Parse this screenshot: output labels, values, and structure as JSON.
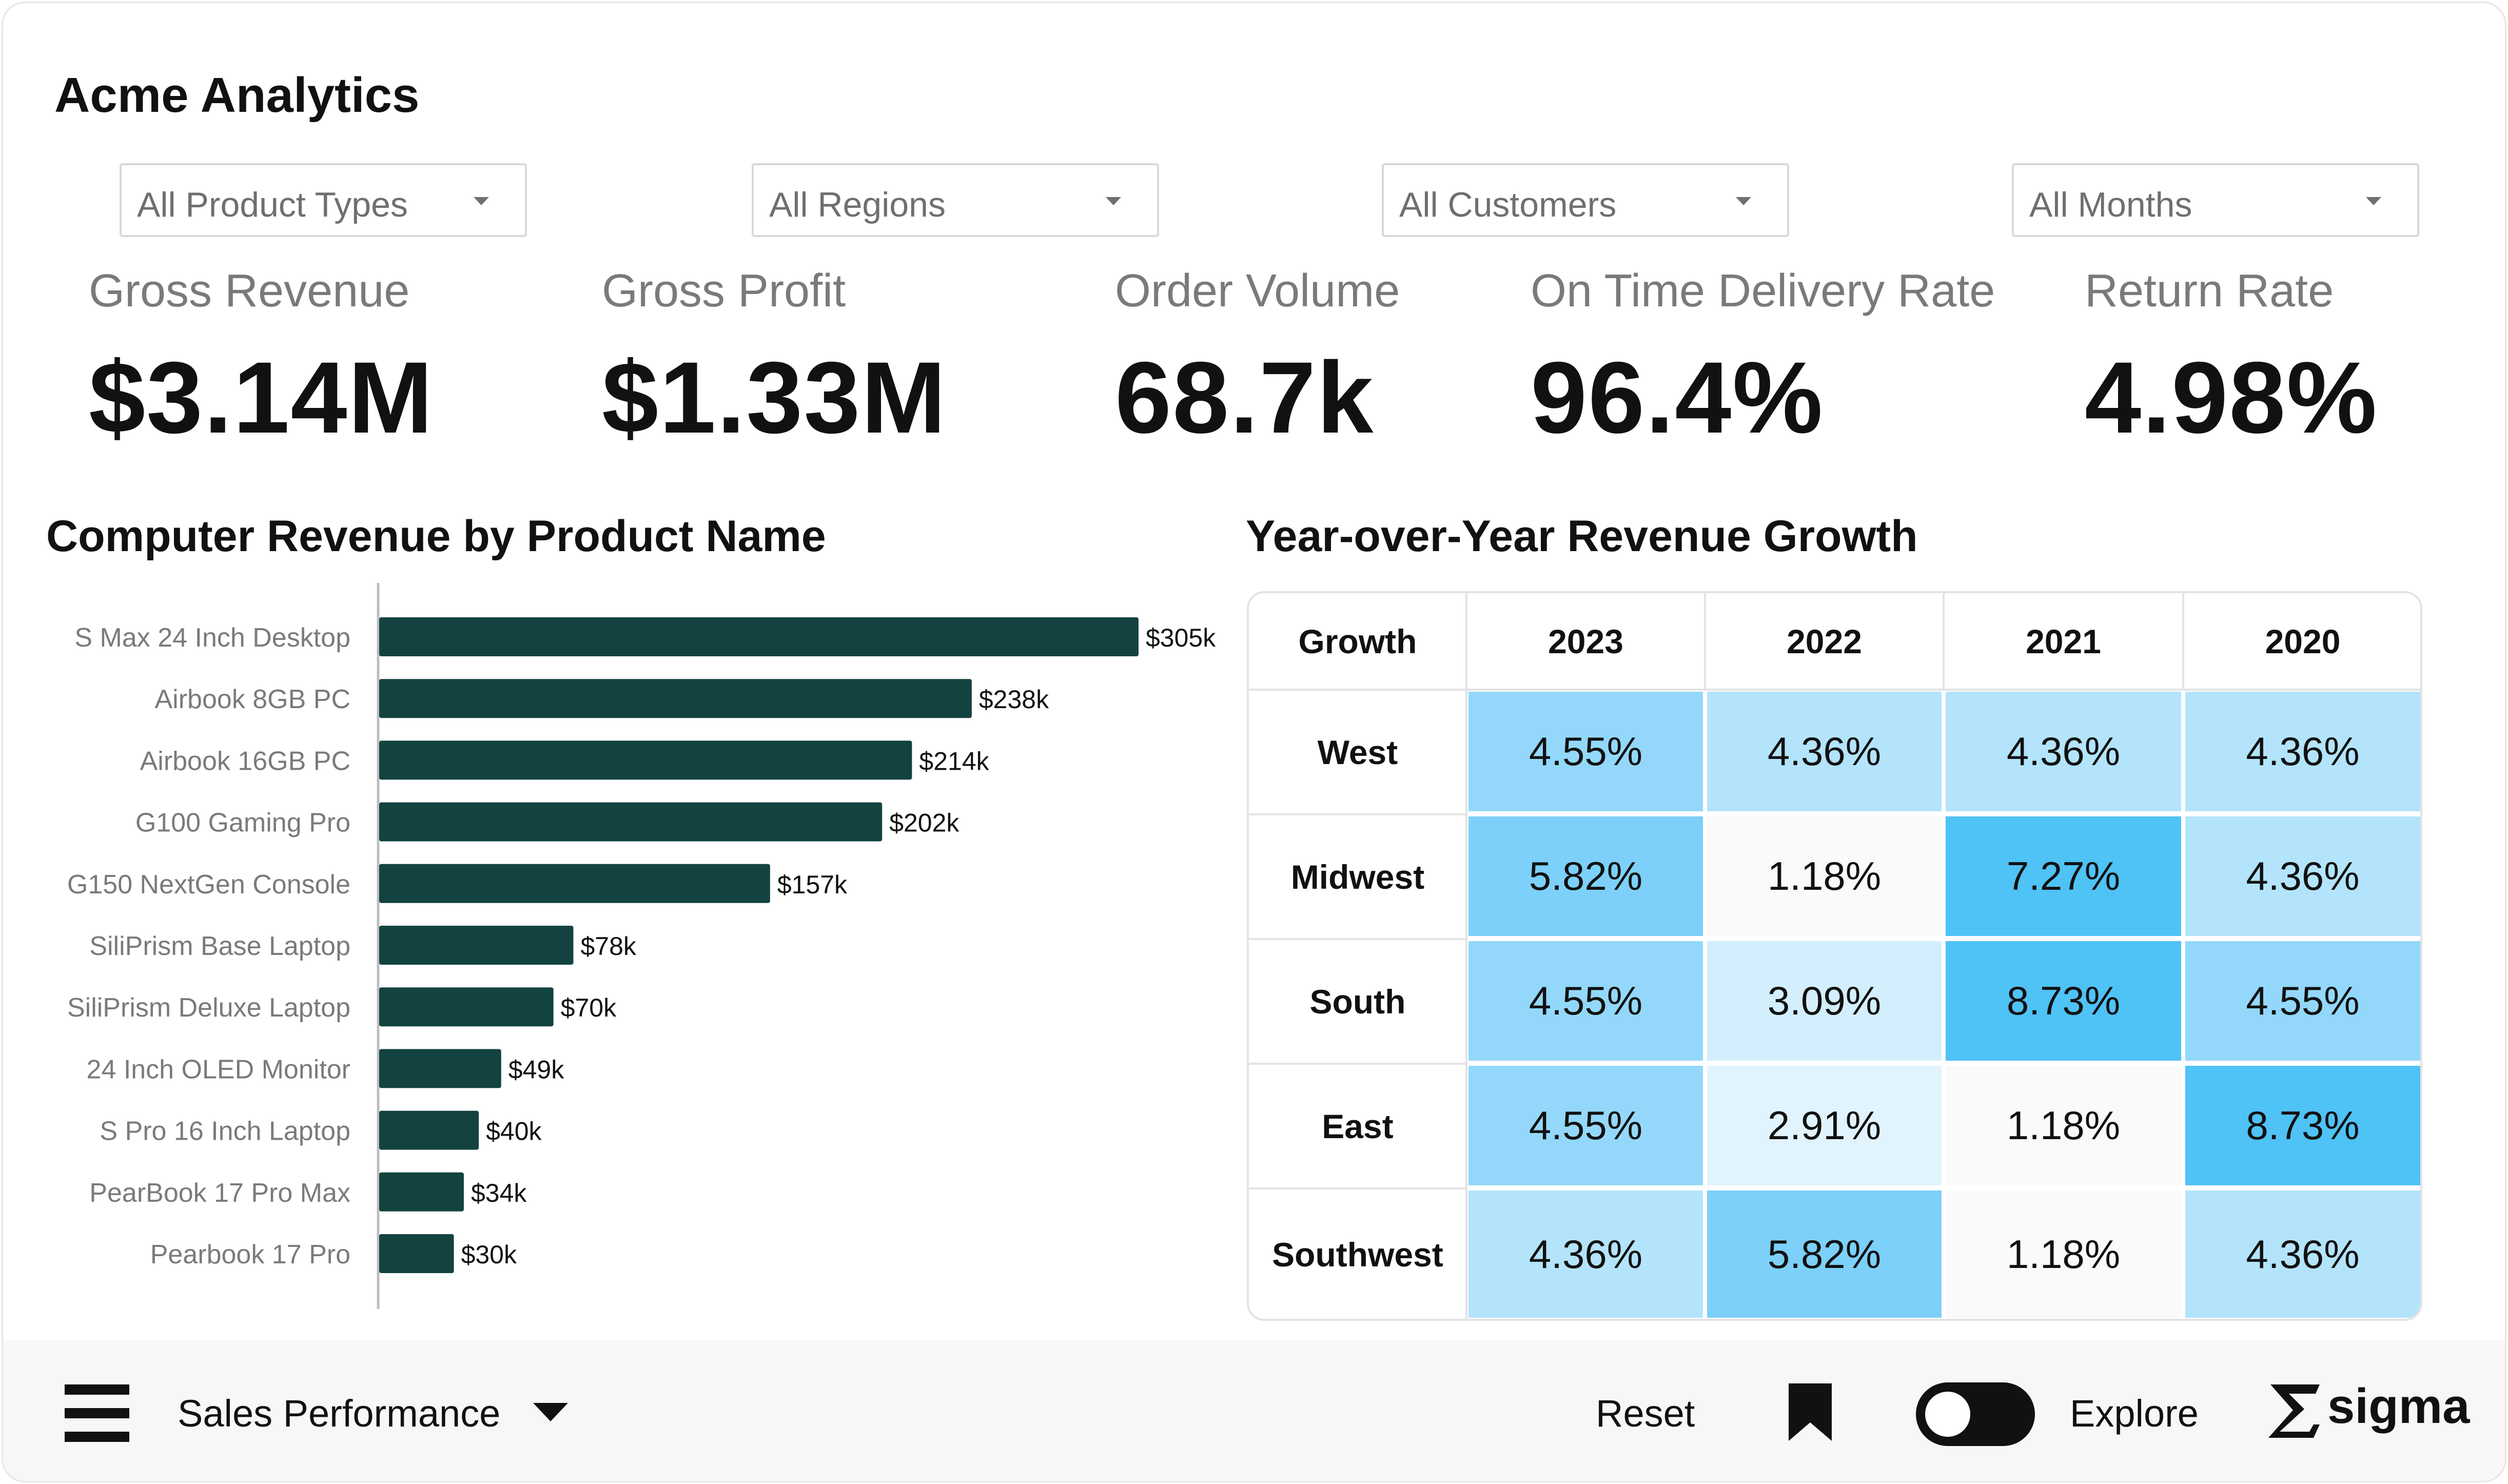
{
  "app": {
    "title": "Acme Analytics"
  },
  "filters": [
    {
      "label": "All Product Types"
    },
    {
      "label": "All Regions"
    },
    {
      "label": "All Customers"
    },
    {
      "label": "All Months"
    }
  ],
  "kpis": [
    {
      "label": "Gross Revenue",
      "value": "$3.14M"
    },
    {
      "label": "Gross Profit",
      "value": "$1.33M"
    },
    {
      "label": "Order Volume",
      "value": "68.7k"
    },
    {
      "label": "On Time Delivery Rate",
      "value": "96.4%"
    },
    {
      "label": "Return Rate",
      "value": "4.98%"
    }
  ],
  "bar_chart": {
    "title": "Computer Revenue by Product Name",
    "bar_color": "#134341"
  },
  "heatmap": {
    "title": "Year-over-Year Revenue Growth",
    "corner_label": "Growth",
    "columns": [
      "2023",
      "2022",
      "2021",
      "2020"
    ],
    "rows": [
      "West",
      "Midwest",
      "South",
      "East",
      "Southwest"
    ],
    "values": [
      [
        "4.55%",
        "4.36%",
        "4.36%",
        "4.36%"
      ],
      [
        "5.82%",
        "1.18%",
        "7.27%",
        "4.36%"
      ],
      [
        "4.55%",
        "3.09%",
        "8.73%",
        "4.55%"
      ],
      [
        "4.55%",
        "2.91%",
        "1.18%",
        "8.73%"
      ],
      [
        "4.36%",
        "5.82%",
        "1.18%",
        "4.36%"
      ]
    ],
    "colors": [
      "#fafafa",
      "#e1f4fe",
      "#d3effd",
      "#b3e4fc",
      "#a6dffb",
      "#93d8fa",
      "#7cd0f9",
      "#4fc2f6",
      "#4fc2f6"
    ]
  },
  "chart_data": {
    "type": "bar",
    "orientation": "horizontal",
    "title": "Computer Revenue by Product Name",
    "categories": [
      "S Max 24 Inch Desktop",
      "Airbook 8GB PC",
      "Airbook 16GB PC",
      "G100 Gaming Pro",
      "G150 NextGen Console",
      "SiliPrism Base Laptop",
      "SiliPrism Deluxe Laptop",
      "24 Inch OLED Monitor",
      "S Pro 16 Inch Laptop",
      "PearBook 17 Pro Max",
      "Pearbook 17 Pro"
    ],
    "values": [
      305000,
      238000,
      214000,
      202000,
      157000,
      78000,
      70000,
      49000,
      40000,
      34000,
      30000
    ],
    "data_labels": [
      "$305k",
      "$238k",
      "$214k",
      "$202k",
      "$157k",
      "$78k",
      "$70k",
      "$49k",
      "$40k",
      "$34k",
      "$30k"
    ],
    "xlabel": "",
    "ylabel": "",
    "xlim": [
      0,
      305000
    ],
    "grid": false
  },
  "footer": {
    "menu_icon": "hamburger-menu-icon",
    "page_name": "Sales Performance",
    "reset_label": "Reset",
    "bookmark_icon": "bookmark-icon",
    "explore_label": "Explore",
    "brand": "sigma"
  }
}
